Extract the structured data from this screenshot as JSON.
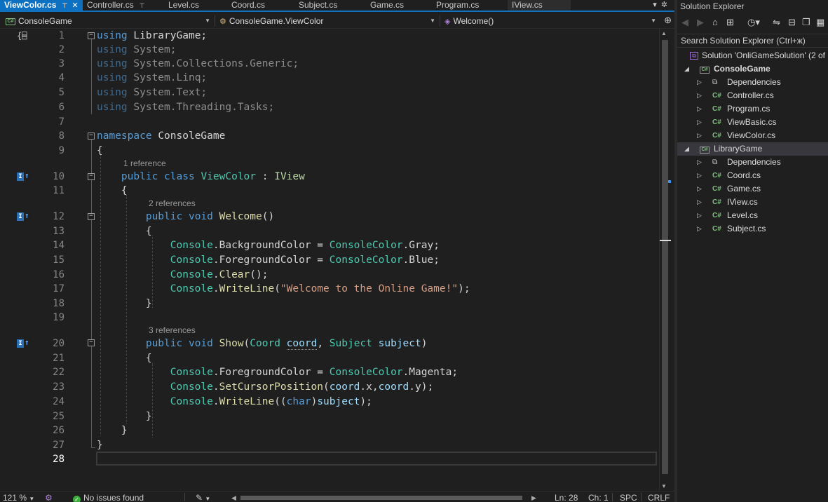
{
  "tabs": [
    {
      "label": "ViewColor.cs",
      "active": true
    },
    {
      "label": "Controller.cs"
    },
    {
      "label": "Level.cs"
    },
    {
      "label": "Coord.cs"
    },
    {
      "label": "Subject.cs"
    },
    {
      "label": "Game.cs"
    },
    {
      "label": "Program.cs"
    },
    {
      "label": "IView.cs"
    }
  ],
  "navbar": {
    "project": "ConsoleGame",
    "class": "ConsoleGame.ViewColor",
    "member": "Welcome()"
  },
  "editor": {
    "references": {
      "r1": "1 reference",
      "r2": "2 references",
      "r3": "3 references"
    },
    "line_numbers": [
      "1",
      "2",
      "3",
      "4",
      "5",
      "6",
      "7",
      "8",
      "9",
      "10",
      "11",
      "12",
      "13",
      "14",
      "15",
      "16",
      "17",
      "18",
      "19",
      "20",
      "21",
      "22",
      "23",
      "24",
      "25",
      "26",
      "27",
      "28"
    ],
    "code": {
      "using_kw": "using",
      "ns1": "LibraryGame",
      "ns2": "System",
      "ns3": "System.Collections.Generic",
      "ns4": "System.Linq",
      "ns5": "System.Text",
      "ns6": "System.Threading.Tasks",
      "namespace_kw": "namespace",
      "namespace_name": "ConsoleGame",
      "public_kw": "public",
      "class_kw": "class",
      "void_kw": "void",
      "char_kw": "char",
      "class_name": "ViewColor",
      "interface_name": "IView",
      "method1": "Welcome",
      "method2": "Show",
      "console": "Console",
      "console_color": "ConsoleColor",
      "background_color": "BackgroundColor",
      "foreground_color": "ForegroundColor",
      "gray": "Gray",
      "blue": "Blue",
      "magenta": "Magenta",
      "clear": "Clear",
      "write_line": "WriteLine",
      "set_cursor_position": "SetCursorPosition",
      "welcome_string": "\"Welcome to the Online Game!\"",
      "coord_type": "Coord",
      "coord_param": "coord",
      "subject_type": "Subject",
      "subject_param": "subject",
      "x": "x",
      "y": "y"
    }
  },
  "status": {
    "zoom": "121 %",
    "issues": "No issues found",
    "ln": "Ln: 28",
    "ch": "Ch: 1",
    "spc": "SPC",
    "crlf": "CRLF"
  },
  "solution_explorer": {
    "title": "Solution Explorer",
    "search_placeholder": "Search Solution Explorer (Ctrl+ж)",
    "solution": "Solution 'OnliGameSolution' (2 of",
    "projects": [
      {
        "name": "ConsoleGame",
        "items": [
          "Dependencies",
          "Controller.cs",
          "Program.cs",
          "ViewBasic.cs",
          "ViewColor.cs"
        ]
      },
      {
        "name": "LibraryGame",
        "items": [
          "Dependencies",
          "Coord.cs",
          "Game.cs",
          "IView.cs",
          "Level.cs",
          "Subject.cs"
        ]
      }
    ]
  },
  "colors": {
    "accent": "#0e70c0",
    "keyword": "#569cd6",
    "type": "#4ec9b0",
    "method": "#dcdcaa",
    "string": "#d69d85",
    "parameter": "#9cdcfe"
  }
}
